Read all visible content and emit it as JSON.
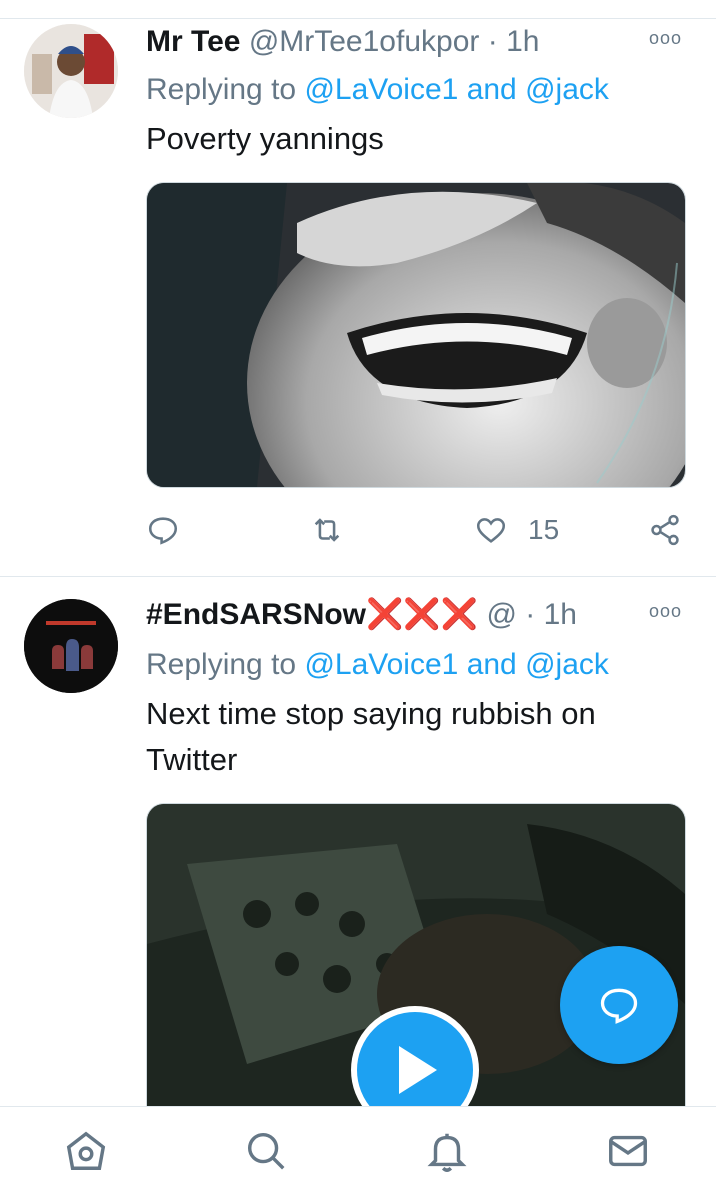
{
  "tweets": [
    {
      "name": "Mr Tee",
      "handle": "@MrTee1ofukpor",
      "dot": "·",
      "time": "1h",
      "reply_prefix": "Replying to",
      "mention1": "@LaVoice1",
      "and": "and",
      "mention2": "@jack",
      "text": "Poverty yannings",
      "media": "photo",
      "likes": "15"
    },
    {
      "name": "#EndSARSNow",
      "name_suffix": "❌❌❌",
      "handle": "@",
      "dot": "·",
      "time": "1h",
      "reply_prefix": "Replying to",
      "mention1": "@LaVoice1",
      "and": "and",
      "mention2": "@jack",
      "text": "Next time stop saying rubbish on Twitter",
      "media": "video"
    }
  ],
  "more_glyph": "ooo",
  "colors": {
    "accent": "#1da1f2",
    "secondary": "#657786",
    "like": "#e0245e"
  },
  "icons": [
    "reply-icon",
    "retweet-icon",
    "heart-icon",
    "share-icon",
    "compose-reply-icon",
    "play-icon",
    "home-icon",
    "search-icon",
    "bell-icon",
    "mail-icon"
  ]
}
